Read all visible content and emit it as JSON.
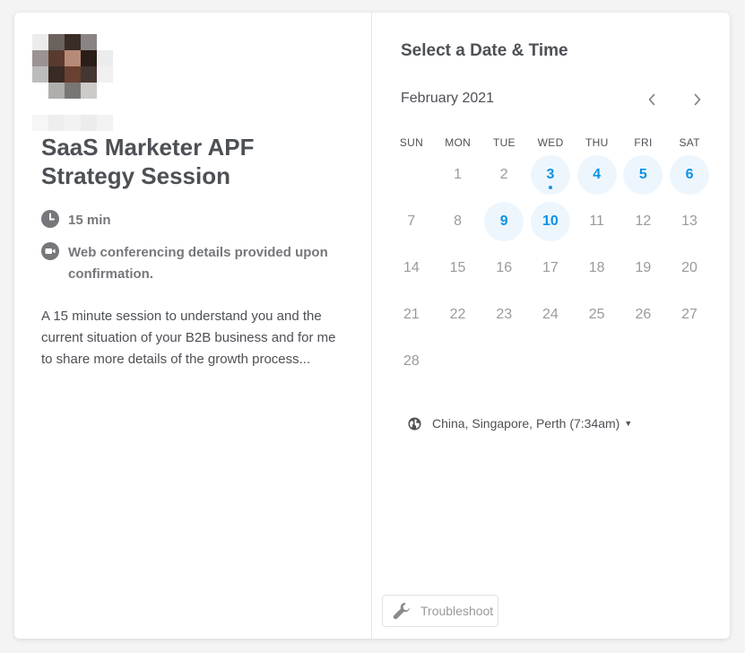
{
  "event": {
    "title": "SaaS Marketer APF Strategy Session",
    "duration": "15 min",
    "conferencing": "Web conferencing details provided upon confirmation.",
    "description": "A 15 minute session to understand you and the current situation of your B2B business and for me to share more details of the growth process..."
  },
  "picker": {
    "title": "Select a Date & Time",
    "month": "February 2021",
    "prev_icon": "chevron-left-icon",
    "next_icon": "chevron-right-icon",
    "weekdays": [
      "SUN",
      "MON",
      "TUE",
      "WED",
      "THU",
      "FRI",
      "SAT"
    ],
    "first_weekday_index": 1,
    "days": [
      {
        "n": "1",
        "available": false
      },
      {
        "n": "2",
        "available": false
      },
      {
        "n": "3",
        "available": true,
        "today": true
      },
      {
        "n": "4",
        "available": true
      },
      {
        "n": "5",
        "available": true
      },
      {
        "n": "6",
        "available": true
      },
      {
        "n": "7",
        "available": false
      },
      {
        "n": "8",
        "available": false
      },
      {
        "n": "9",
        "available": true
      },
      {
        "n": "10",
        "available": true
      },
      {
        "n": "11",
        "available": false
      },
      {
        "n": "12",
        "available": false
      },
      {
        "n": "13",
        "available": false
      },
      {
        "n": "14",
        "available": false
      },
      {
        "n": "15",
        "available": false
      },
      {
        "n": "16",
        "available": false
      },
      {
        "n": "17",
        "available": false
      },
      {
        "n": "18",
        "available": false
      },
      {
        "n": "19",
        "available": false
      },
      {
        "n": "20",
        "available": false
      },
      {
        "n": "21",
        "available": false
      },
      {
        "n": "22",
        "available": false
      },
      {
        "n": "23",
        "available": false
      },
      {
        "n": "24",
        "available": false
      },
      {
        "n": "25",
        "available": false
      },
      {
        "n": "26",
        "available": false
      },
      {
        "n": "27",
        "available": false
      },
      {
        "n": "28",
        "available": false
      }
    ],
    "timezone": "China, Singapore, Perth (7:34am)"
  },
  "footer": {
    "troubleshoot_label": "Troubleshoot"
  },
  "colors": {
    "accent": "#0b93e6",
    "available_bg": "#eef6fd",
    "text": "#4d5055",
    "muted": "#9a9a9a"
  }
}
